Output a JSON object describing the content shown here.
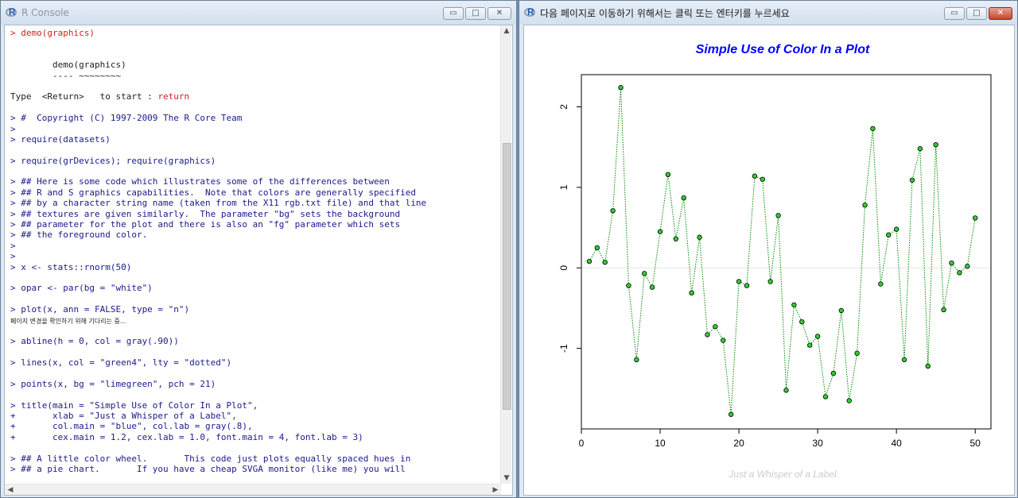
{
  "console_window": {
    "title": "R Console",
    "buttons": {
      "minimize": "▭",
      "maximize": "□",
      "close": "✕"
    },
    "lines": [
      {
        "text": "> demo(graphics)",
        "style": "red"
      },
      {
        "text": "",
        "style": ""
      },
      {
        "text": "",
        "style": ""
      },
      {
        "text": "        demo(graphics)",
        "style": "dark"
      },
      {
        "text": "        ---- ~~~~~~~~",
        "style": "dark"
      },
      {
        "text": "",
        "style": ""
      },
      {
        "text": "Type  <Return>   to start : ",
        "style": "dark",
        "tail": "return",
        "tail_style": "red"
      },
      {
        "text": "",
        "style": ""
      },
      {
        "text": "> #  Copyright (C) 1997-2009 The R Core Team",
        "style": ""
      },
      {
        "text": ">",
        "style": ""
      },
      {
        "text": "> require(datasets)",
        "style": ""
      },
      {
        "text": "",
        "style": ""
      },
      {
        "text": "> require(grDevices); require(graphics)",
        "style": ""
      },
      {
        "text": "",
        "style": ""
      },
      {
        "text": "> ## Here is some code which illustrates some of the differences between",
        "style": ""
      },
      {
        "text": "> ## R and S graphics capabilities.  Note that colors are generally specified",
        "style": ""
      },
      {
        "text": "> ## by a character string name (taken from the X11 rgb.txt file) and that line",
        "style": ""
      },
      {
        "text": "> ## textures are given similarly.  The parameter \"bg\" sets the background",
        "style": ""
      },
      {
        "text": "> ## parameter for the plot and there is also an \"fg\" parameter which sets",
        "style": ""
      },
      {
        "text": "> ## the foreground color.",
        "style": ""
      },
      {
        "text": ">",
        "style": ""
      },
      {
        "text": ">",
        "style": ""
      },
      {
        "text": "> x <- stats::rnorm(50)",
        "style": ""
      },
      {
        "text": "",
        "style": ""
      },
      {
        "text": "> opar <- par(bg = \"white\")",
        "style": ""
      },
      {
        "text": "",
        "style": ""
      },
      {
        "text": "> plot(x, ann = FALSE, type = \"n\")",
        "style": ""
      },
      {
        "text": "페이지 변경을 확인하기 위해 기다리는 중...",
        "style": "small"
      },
      {
        "text": "",
        "style": ""
      },
      {
        "text": "> abline(h = 0, col = gray(.90))",
        "style": ""
      },
      {
        "text": "",
        "style": ""
      },
      {
        "text": "> lines(x, col = \"green4\", lty = \"dotted\")",
        "style": ""
      },
      {
        "text": "",
        "style": ""
      },
      {
        "text": "> points(x, bg = \"limegreen\", pch = 21)",
        "style": ""
      },
      {
        "text": "",
        "style": ""
      },
      {
        "text": "> title(main = \"Simple Use of Color In a Plot\",",
        "style": ""
      },
      {
        "text": "+       xlab = \"Just a Whisper of a Label\",",
        "style": ""
      },
      {
        "text": "+       col.main = \"blue\", col.lab = gray(.8),",
        "style": ""
      },
      {
        "text": "+       cex.main = 1.2, cex.lab = 1.0, font.main = 4, font.lab = 3)",
        "style": ""
      },
      {
        "text": "",
        "style": ""
      },
      {
        "text": "> ## A little color wheel.       This code just plots equally spaced hues in",
        "style": ""
      },
      {
        "text": "> ## a pie chart.       If you have a cheap SVGA monitor (like me) you will",
        "style": ""
      }
    ]
  },
  "graphics_window": {
    "title": "다음 페이지로 이동하기 위해서는 클릭 또는 엔터키를 누르세요",
    "buttons": {
      "minimize": "▭",
      "maximize": "□",
      "close": "✕"
    }
  },
  "chart_data": {
    "type": "scatter",
    "title": "Simple Use of Color In a Plot",
    "xlabel": "Just a Whisper of a Label",
    "ylabel": "",
    "xlim": [
      0,
      52
    ],
    "ylim": [
      -2.0,
      2.4
    ],
    "xticks": [
      0,
      10,
      20,
      30,
      40,
      50
    ],
    "yticks": [
      -1,
      0,
      1,
      2
    ],
    "reference_line_y": 0,
    "reference_line_color": "#e5e5e5",
    "line_color": "#008b00",
    "point_fill": "#32cd32",
    "title_color": "#0000ff",
    "xlabel_color": "#cccccc",
    "x": [
      1,
      2,
      3,
      4,
      5,
      6,
      7,
      8,
      9,
      10,
      11,
      12,
      13,
      14,
      15,
      16,
      17,
      18,
      19,
      20,
      21,
      22,
      23,
      24,
      25,
      26,
      27,
      28,
      29,
      30,
      31,
      32,
      33,
      34,
      35,
      36,
      37,
      38,
      39,
      40,
      41,
      42,
      43,
      44,
      45,
      46,
      47,
      48,
      49,
      50
    ],
    "values": [
      0.08,
      0.25,
      0.07,
      0.71,
      2.24,
      -0.22,
      -1.14,
      -0.07,
      -0.24,
      0.45,
      1.16,
      0.36,
      0.87,
      -0.31,
      0.38,
      -0.83,
      -0.73,
      -0.9,
      -1.82,
      -0.17,
      -0.22,
      1.14,
      1.1,
      -0.17,
      0.65,
      -1.52,
      -0.46,
      -0.67,
      -0.96,
      -0.85,
      -1.6,
      -1.31,
      -0.53,
      -1.65,
      -1.06,
      0.78,
      1.73,
      -0.2,
      0.41,
      0.48,
      -1.14,
      1.09,
      1.48,
      -1.22,
      1.53,
      -0.52,
      0.06,
      -0.06,
      0.02,
      0.62
    ]
  }
}
